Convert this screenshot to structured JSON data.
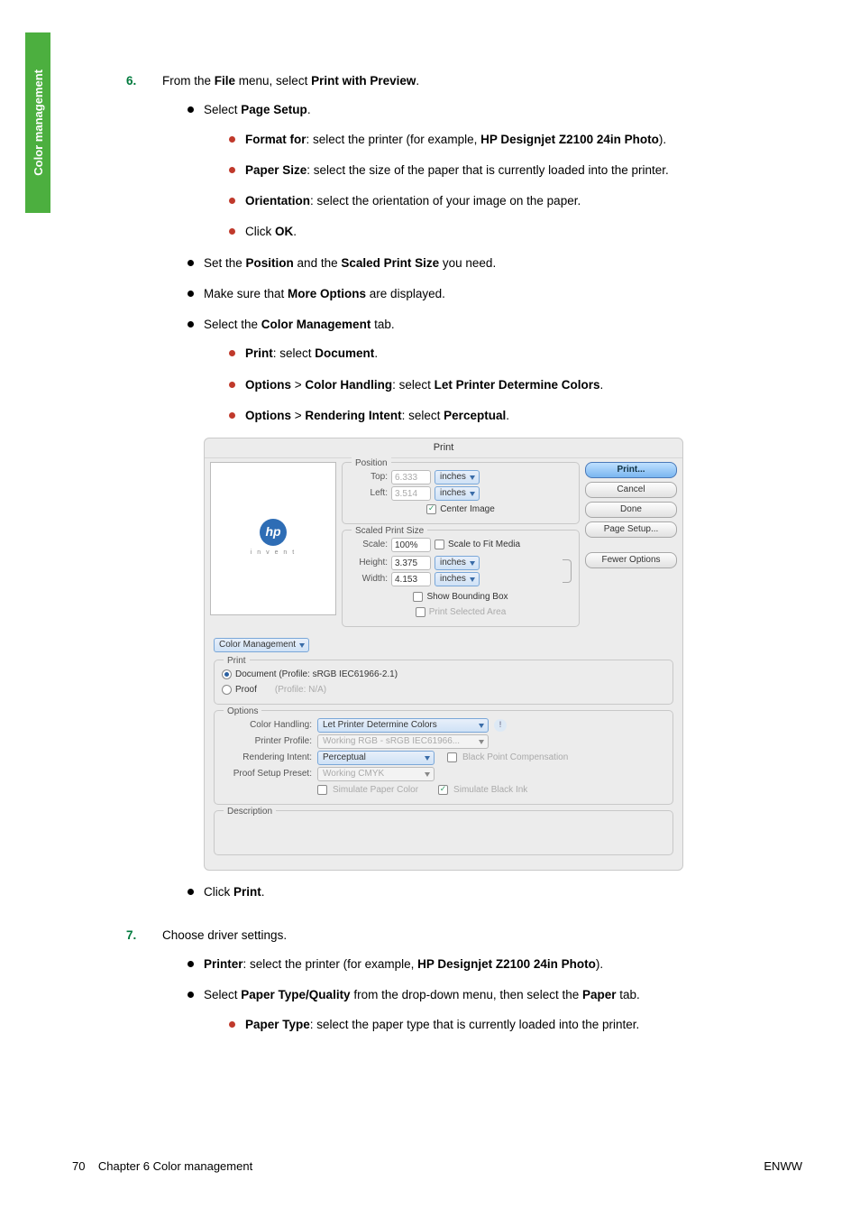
{
  "sideTab": "Color management",
  "steps": {
    "six": {
      "num": "6.",
      "intro_a": "From the ",
      "intro_b": "File",
      "intro_c": " menu, select ",
      "intro_d": "Print with Preview",
      "intro_e": ".",
      "b1_a": "Select ",
      "b1_b": "Page Setup",
      "b1_c": ".",
      "s1_a": "Format for",
      "s1_b": ": select the printer (for example, ",
      "s1_c": "HP Designjet Z2100 24in Photo",
      "s1_d": ").",
      "s2_a": "Paper Size",
      "s2_b": ": select the size of the paper that is currently loaded into the printer.",
      "s3_a": "Orientation",
      "s3_b": ": select the orientation of your image on the paper.",
      "s4_a": "Click ",
      "s4_b": "OK",
      "s4_c": ".",
      "b2_a": "Set the ",
      "b2_b": "Position",
      "b2_c": " and the ",
      "b2_d": "Scaled Print Size",
      "b2_e": " you need.",
      "b3_a": "Make sure that ",
      "b3_b": "More Options",
      "b3_c": " are displayed.",
      "b4_a": "Select the ",
      "b4_b": "Color Management",
      "b4_c": " tab.",
      "s5_a": "Print",
      "s5_b": ": select ",
      "s5_c": "Document",
      "s5_d": ".",
      "s6_a": "Options",
      "s6_b": " > ",
      "s6_c": "Color Handling",
      "s6_d": ": select ",
      "s6_e": "Let Printer Determine Colors",
      "s6_f": ".",
      "s7_a": "Options",
      "s7_b": " > ",
      "s7_c": "Rendering Intent",
      "s7_d": ": select ",
      "s7_e": "Perceptual",
      "s7_f": ".",
      "b5_a": "Click ",
      "b5_b": "Print",
      "b5_c": "."
    },
    "seven": {
      "num": "7.",
      "intro": "Choose driver settings.",
      "b1_a": "Printer",
      "b1_b": ": select the printer (for example, ",
      "b1_c": "HP Designjet Z2100 24in Photo",
      "b1_d": ").",
      "b2_a": "Select ",
      "b2_b": "Paper Type/Quality",
      "b2_c": " from the drop-down menu, then select the ",
      "b2_d": "Paper",
      "b2_e": " tab.",
      "s1_a": "Paper Type",
      "s1_b": ": select the paper type that is currently loaded into the printer."
    }
  },
  "dialog": {
    "title": "Print",
    "logoSub": "i n v e n t",
    "position": {
      "legend": "Position",
      "topLabel": "Top:",
      "topVal": "6.333",
      "leftLabel": "Left:",
      "leftVal": "3.514",
      "unit": "inches",
      "center": "Center Image"
    },
    "scaled": {
      "legend": "Scaled Print Size",
      "scaleLabel": "Scale:",
      "scaleVal": "100%",
      "scaleFit": "Scale to Fit Media",
      "heightLabel": "Height:",
      "heightVal": "3.375",
      "widthLabel": "Width:",
      "widthVal": "4.153",
      "unit": "inches",
      "bounding": "Show Bounding Box",
      "selected": "Print Selected Area"
    },
    "buttons": {
      "print": "Print...",
      "cancel": "Cancel",
      "done": "Done",
      "pageSetup": "Page Setup...",
      "fewer": "Fewer Options"
    },
    "tab": "Color Management",
    "printGroup": {
      "legend": "Print",
      "doc": "Document  (Profile: sRGB IEC61966-2.1)",
      "proof": "Proof",
      "proofProfile": "(Profile: N/A)"
    },
    "options": {
      "legend": "Options",
      "colorHandlingLabel": "Color Handling:",
      "colorHandlingVal": "Let Printer Determine Colors",
      "printerProfileLabel": "Printer Profile:",
      "printerProfileVal": "Working RGB - sRGB IEC61966...",
      "renderingLabel": "Rendering Intent:",
      "renderingVal": "Perceptual",
      "bpc": "Black Point Compensation",
      "proofSetupLabel": "Proof Setup Preset:",
      "proofSetupVal": "Working CMYK",
      "simPaper": "Simulate Paper Color",
      "simBlack": "Simulate Black Ink"
    },
    "description": {
      "legend": "Description"
    }
  },
  "footer": {
    "pageNum": "70",
    "chapter": "Chapter 6   Color management",
    "right": "ENWW"
  }
}
